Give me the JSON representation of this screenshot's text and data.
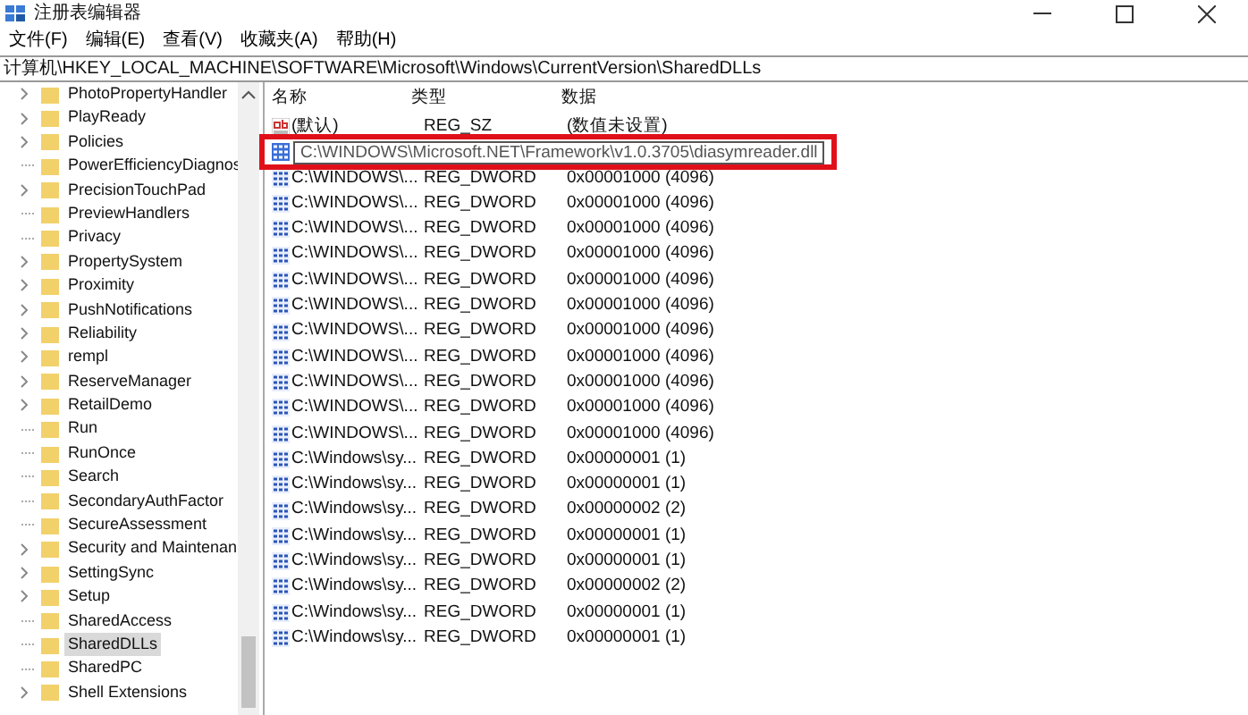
{
  "window": {
    "title": "注册表编辑器"
  },
  "menu": [
    "文件(F)",
    "编辑(E)",
    "查看(V)",
    "收藏夹(A)",
    "帮助(H)"
  ],
  "address": "计算机\\HKEY_LOCAL_MACHINE\\SOFTWARE\\Microsoft\\Windows\\CurrentVersion\\SharedDLLs",
  "tree": [
    {
      "label": "PhotoPropertyHandler",
      "expandable": true,
      "selected": false
    },
    {
      "label": "PlayReady",
      "expandable": true,
      "selected": false
    },
    {
      "label": "Policies",
      "expandable": true,
      "selected": false
    },
    {
      "label": "PowerEfficiencyDiagnos",
      "expandable": false,
      "selected": false
    },
    {
      "label": "PrecisionTouchPad",
      "expandable": true,
      "selected": false
    },
    {
      "label": "PreviewHandlers",
      "expandable": false,
      "selected": false
    },
    {
      "label": "Privacy",
      "expandable": false,
      "selected": false
    },
    {
      "label": "PropertySystem",
      "expandable": true,
      "selected": false
    },
    {
      "label": "Proximity",
      "expandable": true,
      "selected": false
    },
    {
      "label": "PushNotifications",
      "expandable": true,
      "selected": false
    },
    {
      "label": "Reliability",
      "expandable": true,
      "selected": false
    },
    {
      "label": "rempl",
      "expandable": true,
      "selected": false
    },
    {
      "label": "ReserveManager",
      "expandable": true,
      "selected": false
    },
    {
      "label": "RetailDemo",
      "expandable": true,
      "selected": false
    },
    {
      "label": "Run",
      "expandable": false,
      "selected": false
    },
    {
      "label": "RunOnce",
      "expandable": false,
      "selected": false
    },
    {
      "label": "Search",
      "expandable": false,
      "selected": false
    },
    {
      "label": "SecondaryAuthFactor",
      "expandable": false,
      "selected": false
    },
    {
      "label": "SecureAssessment",
      "expandable": false,
      "selected": false
    },
    {
      "label": "Security and Maintenan",
      "expandable": true,
      "selected": false
    },
    {
      "label": "SettingSync",
      "expandable": true,
      "selected": false
    },
    {
      "label": "Setup",
      "expandable": true,
      "selected": false
    },
    {
      "label": "SharedAccess",
      "expandable": false,
      "selected": false
    },
    {
      "label": "SharedDLLs",
      "expandable": false,
      "selected": true
    },
    {
      "label": "SharedPC",
      "expandable": false,
      "selected": false
    },
    {
      "label": "Shell Extensions",
      "expandable": true,
      "selected": false
    }
  ],
  "table": {
    "columns": [
      "名称",
      "类型",
      "数据"
    ],
    "rows": [
      {
        "kind": "string",
        "name": "(默认)",
        "type": "REG_SZ",
        "data": "(数值未设置)",
        "editing": false
      },
      {
        "kind": "dword",
        "name": "C:\\WINDOWS\\Microsoft.NET\\Framework\\v1.0.3705\\diasymreader.dll",
        "editing": true
      },
      {
        "kind": "dword",
        "name": "C:\\WINDOWS\\...",
        "type": "REG_DWORD",
        "data": "0x00001000 (4096)",
        "editing": false
      },
      {
        "kind": "dword",
        "name": "C:\\WINDOWS\\...",
        "type": "REG_DWORD",
        "data": "0x00001000 (4096)",
        "editing": false
      },
      {
        "kind": "dword",
        "name": "C:\\WINDOWS\\...",
        "type": "REG_DWORD",
        "data": "0x00001000 (4096)",
        "editing": false
      },
      {
        "kind": "dword",
        "name": "C:\\WINDOWS\\...",
        "type": "REG_DWORD",
        "data": "0x00001000 (4096)",
        "editing": false
      },
      {
        "kind": "dword",
        "name": "C:\\WINDOWS\\...",
        "type": "REG_DWORD",
        "data": "0x00001000 (4096)",
        "editing": false
      },
      {
        "kind": "dword",
        "name": "C:\\WINDOWS\\...",
        "type": "REG_DWORD",
        "data": "0x00001000 (4096)",
        "editing": false
      },
      {
        "kind": "dword",
        "name": "C:\\WINDOWS\\...",
        "type": "REG_DWORD",
        "data": "0x00001000 (4096)",
        "editing": false
      },
      {
        "kind": "dword",
        "name": "C:\\WINDOWS\\...",
        "type": "REG_DWORD",
        "data": "0x00001000 (4096)",
        "editing": false
      },
      {
        "kind": "dword",
        "name": "C:\\WINDOWS\\...",
        "type": "REG_DWORD",
        "data": "0x00001000 (4096)",
        "editing": false
      },
      {
        "kind": "dword",
        "name": "C:\\WINDOWS\\...",
        "type": "REG_DWORD",
        "data": "0x00001000 (4096)",
        "editing": false
      },
      {
        "kind": "dword",
        "name": "C:\\WINDOWS\\...",
        "type": "REG_DWORD",
        "data": "0x00001000 (4096)",
        "editing": false
      },
      {
        "kind": "dword",
        "name": "C:\\Windows\\sy...",
        "type": "REG_DWORD",
        "data": "0x00000001 (1)",
        "editing": false
      },
      {
        "kind": "dword",
        "name": "C:\\Windows\\sy...",
        "type": "REG_DWORD",
        "data": "0x00000001 (1)",
        "editing": false
      },
      {
        "kind": "dword",
        "name": "C:\\Windows\\sy...",
        "type": "REG_DWORD",
        "data": "0x00000002 (2)",
        "editing": false
      },
      {
        "kind": "dword",
        "name": "C:\\Windows\\sy...",
        "type": "REG_DWORD",
        "data": "0x00000001 (1)",
        "editing": false
      },
      {
        "kind": "dword",
        "name": "C:\\Windows\\sy...",
        "type": "REG_DWORD",
        "data": "0x00000001 (1)",
        "editing": false
      },
      {
        "kind": "dword",
        "name": "C:\\Windows\\sy...",
        "type": "REG_DWORD",
        "data": "0x00000002 (2)",
        "editing": false
      },
      {
        "kind": "dword",
        "name": "C:\\Windows\\sy...",
        "type": "REG_DWORD",
        "data": "0x00000001 (1)",
        "editing": false
      },
      {
        "kind": "dword",
        "name": "C:\\Windows\\sy...",
        "type": "REG_DWORD",
        "data": "0x00000001 (1)",
        "editing": false
      }
    ]
  }
}
